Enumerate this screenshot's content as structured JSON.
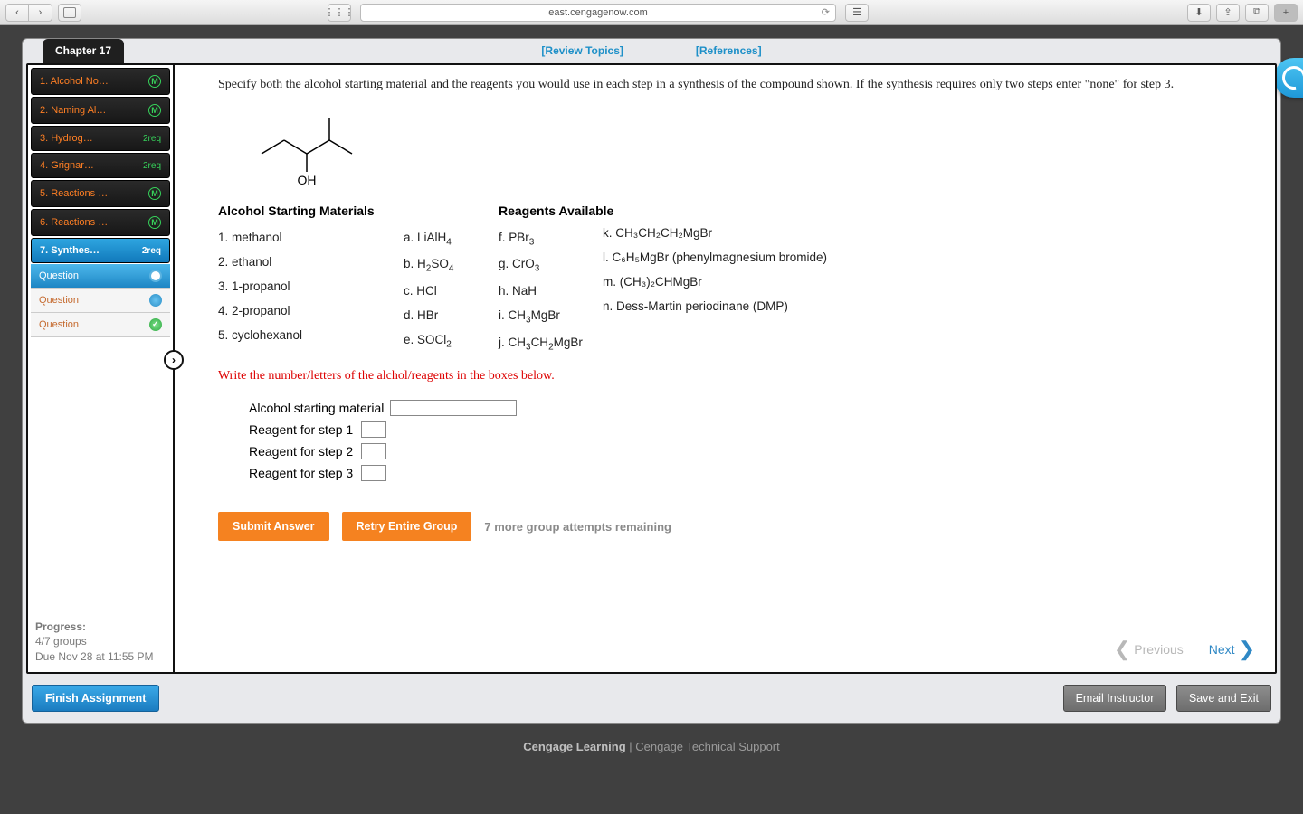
{
  "browser": {
    "url": "east.cengagenow.com"
  },
  "chapter_tab": "Chapter 17",
  "top_links": {
    "review": "[Review Topics]",
    "references": "[References]"
  },
  "sidebar": {
    "items": [
      {
        "label": "1. Alcohol No…",
        "badge_type": "m",
        "badge": "M"
      },
      {
        "label": "2. Naming Al…",
        "badge_type": "m",
        "badge": "M"
      },
      {
        "label": "3. Hydrog…",
        "badge_type": "req",
        "badge": "2req"
      },
      {
        "label": "4. Grignar…",
        "badge_type": "req",
        "badge": "2req"
      },
      {
        "label": "5. Reactions …",
        "badge_type": "m",
        "badge": "M"
      },
      {
        "label": "6. Reactions …",
        "badge_type": "m",
        "badge": "M"
      },
      {
        "label": "7. Synthes…",
        "badge_type": "req",
        "badge": "2req"
      }
    ],
    "subitems": [
      {
        "label": "Question"
      },
      {
        "label": "Question"
      },
      {
        "label": "Question"
      }
    ]
  },
  "progress": {
    "title": "Progress:",
    "groups": "4/7 groups",
    "due": "Due Nov 28 at 11:55 PM"
  },
  "question": {
    "prompt": "Specify both the alcohol starting material and the reagents you would use in each step in a synthesis of the compound shown. If the synthesis requires only two steps enter \"none\" for step 3.",
    "structure_label": "OH",
    "col_heads": {
      "alcohols": "Alcohol Starting Materials",
      "reagents": "Reagents Available"
    },
    "alcohols": [
      "1. methanol",
      "2. ethanol",
      "3. 1-propanol",
      "4. 2-propanol",
      "5. cyclohexanol"
    ],
    "reagents_a": [
      "a. LiAlH",
      "b. H",
      "c. HCl",
      "d. HBr",
      "e. SOCl"
    ],
    "reagents_a_sub": [
      "4",
      "2",
      "",
      "",
      "2"
    ],
    "reagents_a_extra": [
      "",
      "SO",
      "",
      "",
      ""
    ],
    "reagents_a_extra_sub": [
      "",
      "4",
      "",
      "",
      ""
    ],
    "reagents_b": [
      "f. PBr",
      "g. CrO",
      "h. NaH",
      "i. CH",
      "j. CH"
    ],
    "reagents_b_sub": [
      "3",
      "3",
      "",
      "3",
      "3"
    ],
    "reagents_b_extra": [
      "",
      "",
      "",
      "MgBr",
      "CH"
    ],
    "reagents_b_extra2": [
      "",
      "",
      "",
      "",
      "2"
    ],
    "reagents_b_extra3": [
      "",
      "",
      "",
      "",
      "MgBr"
    ],
    "reagents_c": [
      "k. CH₃CH₂CH₂MgBr",
      "l. C₆H₅MgBr (phenylmagnesium bromide)",
      "m. (CH₃)₂CHMgBr",
      "n. Dess-Martin periodinane (DMP)"
    ],
    "red_instruction": "Write the number/letters of the alchol/reagents in the boxes below.",
    "answer_labels": {
      "starting": "Alcohol starting material",
      "step1": "Reagent for step 1",
      "step2": "Reagent for step 2",
      "step3": "Reagent for step 3"
    },
    "buttons": {
      "submit": "Submit Answer",
      "retry": "Retry Entire Group"
    },
    "attempts": "7 more group attempts remaining",
    "pager": {
      "prev": "Previous",
      "next": "Next"
    }
  },
  "bottom": {
    "finish": "Finish Assignment",
    "email": "Email Instructor",
    "save": "Save and Exit"
  },
  "footer": {
    "brand": "Cengage Learning",
    "sep": "  |  ",
    "support": "Cengage Technical Support"
  }
}
